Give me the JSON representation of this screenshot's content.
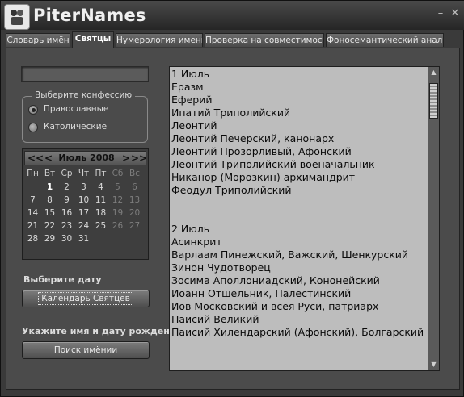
{
  "app": {
    "title": "PiterNames",
    "icon": "app-logo-icon",
    "window_controls": [
      "minimize-icon",
      "close-icon"
    ]
  },
  "tabs": [
    {
      "label": "Словарь имён",
      "active": false
    },
    {
      "label": "Святцы",
      "active": true
    },
    {
      "label": "Нумерология имени",
      "active": false
    },
    {
      "label": "Проверка на совместимость",
      "active": false
    },
    {
      "label": "Фоносемантический анализ",
      "active": false
    }
  ],
  "left": {
    "name_input": {
      "value": ""
    },
    "confession": {
      "title": "Выберите конфессию",
      "options": [
        {
          "label": "Православные",
          "selected": true
        },
        {
          "label": "Католические",
          "selected": false
        }
      ]
    },
    "calendar": {
      "prev_year": "<<",
      "prev_month": "<",
      "month_label": "Июль 2008",
      "next_month": ">",
      "next_year": ">>",
      "weekdays": [
        "Пн",
        "Вт",
        "Ср",
        "Чт",
        "Пт",
        "Сб",
        "Вс"
      ],
      "weeks": [
        [
          "",
          "1",
          "2",
          "3",
          "4",
          "5",
          "6"
        ],
        [
          "7",
          "8",
          "9",
          "10",
          "11",
          "12",
          "13"
        ],
        [
          "14",
          "15",
          "16",
          "17",
          "18",
          "19",
          "20"
        ],
        [
          "21",
          "22",
          "23",
          "24",
          "25",
          "26",
          "27"
        ],
        [
          "28",
          "29",
          "30",
          "31",
          "",
          "",
          ""
        ]
      ],
      "today": "1"
    },
    "choose_date_label": "Выберите дату",
    "calendar_button": "Календарь Святцев",
    "enter_name_label": "Укажите имя и дату рождения",
    "search_button": "Поиск имёнии"
  },
  "list": {
    "lines": [
      "1 Июль",
      "Еразм",
      "Еферий",
      "Ипатий Триполийский",
      "Леонтий",
      "Леонтий Печерский, канонарх",
      "Леонтий Прозорливый, Афонский",
      "Леонтий Триполийский военачальник",
      "Никанор (Морозкин) архимандрит",
      "Феодул Триполийский",
      "",
      "",
      "2 Июль",
      "Асинкрит",
      "Варлаам Пинежский, Важский, Шенкурский",
      "Зинон Чудотворец",
      "Зосима Аполлониадский, Кононейский",
      "Иоанн Отшельник, Палестинский",
      "Иов Московский и всея Руси, патриарх",
      "Паисий Великий",
      "Паисий Хилендарский (Афонский), Болгарский"
    ],
    "scroll_up": "up-arrow-icon",
    "scroll_down": "down-arrow-icon"
  }
}
